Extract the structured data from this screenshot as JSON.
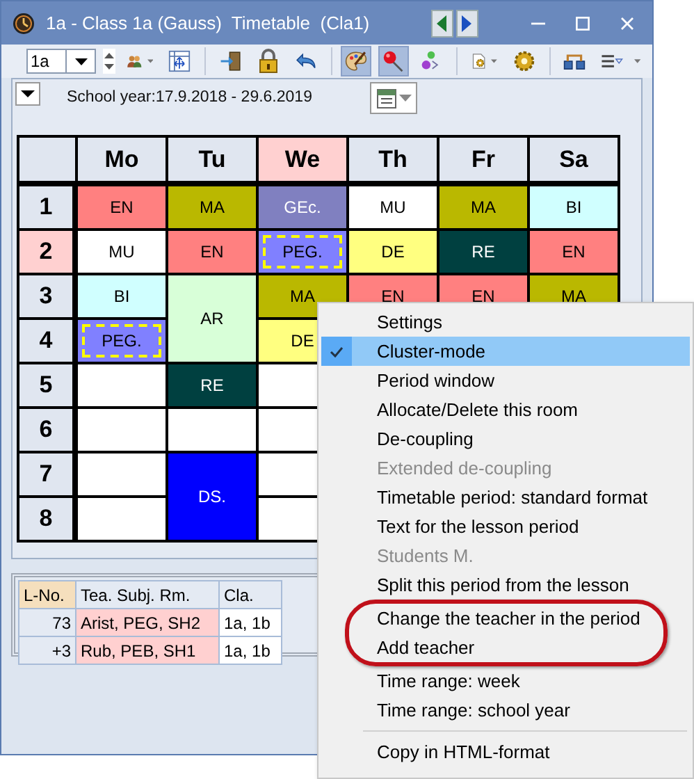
{
  "window": {
    "title": "1a - Class 1a (Gauss)  Timetable  (Cla1)"
  },
  "toolbar": {
    "class_field": {
      "value": "1a"
    },
    "tools": [
      {
        "kind": "people",
        "dropdown": true,
        "pressed": false
      },
      {
        "kind": "grid",
        "dropdown": false,
        "pressed": false
      },
      {
        "kind": "separator"
      },
      {
        "kind": "door",
        "dropdown": false,
        "pressed": false
      },
      {
        "kind": "lock",
        "dropdown": false,
        "pressed": false
      },
      {
        "kind": "undo",
        "dropdown": false,
        "pressed": false
      },
      {
        "kind": "separator"
      },
      {
        "kind": "palette",
        "dropdown": false,
        "pressed": true
      },
      {
        "kind": "pin",
        "dropdown": false,
        "pressed": true
      },
      {
        "kind": "balls",
        "dropdown": false,
        "pressed": false
      },
      {
        "kind": "separator"
      },
      {
        "kind": "docgear",
        "dropdown": true,
        "pressed": false
      },
      {
        "kind": "gear",
        "dropdown": false,
        "pressed": false
      },
      {
        "kind": "separator"
      },
      {
        "kind": "network",
        "dropdown": false,
        "pressed": false
      },
      {
        "kind": "list",
        "dropdown": false,
        "pressed": false
      }
    ]
  },
  "school_year": "School year:17.9.2018 - 29.6.2019",
  "timetable": {
    "days": [
      {
        "label": "Mo",
        "selected": false
      },
      {
        "label": "Tu",
        "selected": false
      },
      {
        "label": "We",
        "selected": true
      },
      {
        "label": "Th",
        "selected": false
      },
      {
        "label": "Fr",
        "selected": false
      },
      {
        "label": "Sa",
        "selected": false
      }
    ],
    "periods": [
      {
        "label": "1",
        "selected": false
      },
      {
        "label": "2",
        "selected": true
      },
      {
        "label": "3",
        "selected": false
      },
      {
        "label": "4",
        "selected": false
      },
      {
        "label": "5",
        "selected": false
      },
      {
        "label": "6",
        "selected": false
      },
      {
        "label": "7",
        "selected": false
      },
      {
        "label": "8",
        "selected": false
      }
    ],
    "rows": [
      {
        "cells": [
          {
            "kind": "lesson",
            "subject": "EN",
            "color": "#ff8080",
            "highlighted": false
          },
          {
            "kind": "lesson",
            "subject": "MA",
            "color": "#bab800",
            "highlighted": false
          },
          {
            "kind": "lesson",
            "subject": "GEc.",
            "color": "#8080c0",
            "highlighted": false
          },
          {
            "kind": "lesson",
            "subject": "MU",
            "color": "#ffffff",
            "highlighted": false
          },
          {
            "kind": "lesson",
            "subject": "MA",
            "color": "#bab800",
            "highlighted": false
          },
          {
            "kind": "lesson",
            "subject": "BI",
            "color": "#d0ffff",
            "highlighted": false
          }
        ]
      },
      {
        "cells": [
          {
            "kind": "lesson",
            "subject": "MU",
            "color": "#ffffff",
            "highlighted": false
          },
          {
            "kind": "lesson",
            "subject": "EN",
            "color": "#ff8080",
            "highlighted": false
          },
          {
            "kind": "lesson",
            "subject": "PEG.",
            "color": "#8080ff",
            "highlighted": true
          },
          {
            "kind": "lesson",
            "subject": "DE",
            "color": "#ffff80",
            "highlighted": false
          },
          {
            "kind": "lesson",
            "subject": "RE",
            "color": "#004040",
            "highlighted": false
          },
          {
            "kind": "lesson",
            "subject": "EN",
            "color": "#ff8080",
            "highlighted": false
          }
        ]
      },
      {
        "cells": [
          {
            "kind": "lesson",
            "subject": "BI",
            "color": "#d0ffff",
            "highlighted": false
          },
          {
            "kind": "lesson",
            "subject": "AR",
            "color": "#d8ffd8",
            "highlighted": false
          },
          {
            "kind": "lesson",
            "subject": "MA",
            "color": "#bab800",
            "highlighted": false
          },
          {
            "kind": "lesson",
            "subject": "EN",
            "color": "#ff8080",
            "highlighted": false
          },
          {
            "kind": "lesson",
            "subject": "EN",
            "color": "#ff8080",
            "highlighted": false
          },
          {
            "kind": "lesson",
            "subject": "MA",
            "color": "#bab800",
            "highlighted": false
          }
        ]
      },
      {
        "cells": [
          {
            "kind": "lesson",
            "subject": "PEG.",
            "color": "#8080ff",
            "highlighted": true
          },
          {
            "kind": "continued"
          },
          {
            "kind": "lesson",
            "subject": "DE",
            "color": "#ffff80",
            "highlighted": false
          }
        ]
      },
      {
        "cells": [
          {
            "kind": "empty"
          },
          {
            "kind": "lesson",
            "subject": "RE",
            "color": "#004040",
            "highlighted": false
          },
          {
            "kind": "empty"
          }
        ]
      },
      {
        "cells": [
          {
            "kind": "empty"
          },
          {
            "kind": "empty"
          },
          {
            "kind": "empty"
          }
        ]
      },
      {
        "cells": [
          {
            "kind": "empty"
          },
          {
            "kind": "lesson",
            "subject": "DS.",
            "color": "#0000ff",
            "highlighted": false
          },
          {
            "kind": "empty"
          }
        ]
      },
      {
        "cells": [
          {
            "kind": "empty"
          },
          {
            "kind": "continued"
          },
          {
            "kind": "empty"
          }
        ]
      }
    ]
  },
  "lesson_table": {
    "columns": [
      "L-No.",
      "Tea. Subj. Rm.",
      "Cla."
    ],
    "rows": [
      [
        "73",
        "Arist, PEG, SH2",
        "1a, 1b"
      ],
      [
        "+3",
        "Rub, PEB, SH1",
        "1a, 1b"
      ]
    ]
  },
  "context_menu": {
    "items": [
      {
        "kind": "item",
        "label": "Settings",
        "checked": false,
        "selected": false,
        "disabled": false
      },
      {
        "kind": "item",
        "label": "Cluster-mode",
        "checked": true,
        "selected": true,
        "disabled": false
      },
      {
        "kind": "item",
        "label": "Period window",
        "checked": false,
        "selected": false,
        "disabled": false
      },
      {
        "kind": "item",
        "label": "Allocate/Delete this room",
        "checked": false,
        "selected": false,
        "disabled": false
      },
      {
        "kind": "item",
        "label": "De-coupling",
        "checked": false,
        "selected": false,
        "disabled": false
      },
      {
        "kind": "item",
        "label": "Extended de-coupling",
        "checked": false,
        "selected": false,
        "disabled": true
      },
      {
        "kind": "item",
        "label": "Timetable period: standard format",
        "checked": false,
        "selected": false,
        "disabled": false
      },
      {
        "kind": "item",
        "label": "Text for the lesson period",
        "checked": false,
        "selected": false,
        "disabled": false
      },
      {
        "kind": "item",
        "label": "Students M.",
        "checked": false,
        "selected": false,
        "disabled": true
      },
      {
        "kind": "item",
        "label": "Split this period from the lesson",
        "checked": false,
        "selected": false,
        "disabled": false
      },
      {
        "kind": "item",
        "label": "Change the teacher in the period",
        "checked": false,
        "selected": false,
        "disabled": false,
        "circled": true
      },
      {
        "kind": "item",
        "label": "Add teacher",
        "checked": false,
        "selected": false,
        "disabled": false,
        "circled": true
      },
      {
        "kind": "item",
        "label": "Time range: week",
        "checked": false,
        "selected": false,
        "disabled": false
      },
      {
        "kind": "item",
        "label": "Time range: school year",
        "checked": false,
        "selected": false,
        "disabled": false
      },
      {
        "kind": "separator"
      },
      {
        "kind": "item",
        "label": "Copy in HTML-format",
        "checked": false,
        "selected": false,
        "disabled": false
      }
    ]
  }
}
